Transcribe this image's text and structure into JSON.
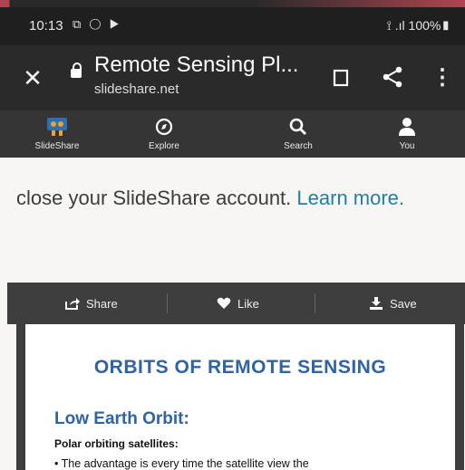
{
  "status_bar": {
    "time": "10:13",
    "notification_icons": "⧉ ◯ ▶",
    "right": "⟟ .ıl 100%▮"
  },
  "browser": {
    "close_icon": "close-icon",
    "page_title": "Remote Sensing Pl...",
    "domain": "slideshare.net",
    "icons": [
      "lock-icon",
      "bookmark-icon",
      "share-icon",
      "more-vert-icon"
    ]
  },
  "app_nav": {
    "items": [
      {
        "label": "SlideShare",
        "icon": "slideshare-logo-icon"
      },
      {
        "label": "Explore",
        "icon": "compass-icon"
      },
      {
        "label": "Search",
        "icon": "search-icon"
      },
      {
        "label": "You",
        "icon": "person-icon"
      }
    ]
  },
  "notice": {
    "text": "close your SlideShare account. ",
    "link": "Learn more."
  },
  "doc_actions": {
    "share": "Share",
    "like": "Like",
    "save": "Save"
  },
  "slide": {
    "title": "ORBITS OF REMOTE SENSING",
    "heading": "Low Earth Orbit:",
    "subheading": "Polar orbiting satellites:",
    "bullet": "• The advantage is every time the satellite view the"
  },
  "colors": {
    "link": "#1f7fa8",
    "slide_heading": "#2f63a4",
    "toolbar": "#2a2a2a"
  }
}
